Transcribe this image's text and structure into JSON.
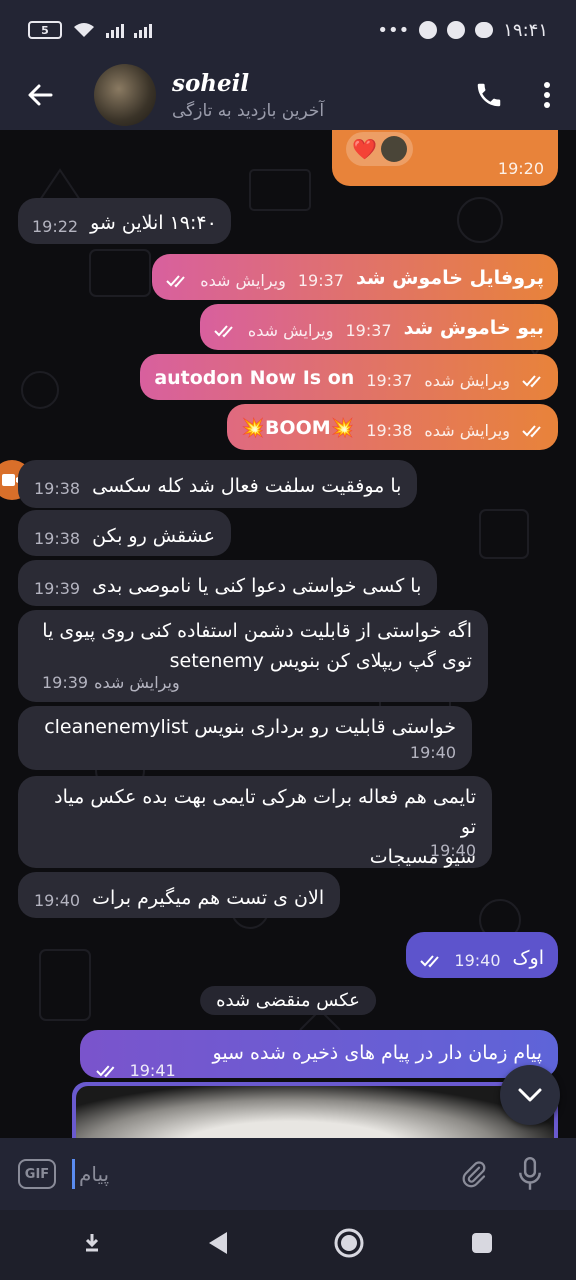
{
  "status_bar": {
    "time": "۱۹:۴۱",
    "battery": "5",
    "dots": "•••"
  },
  "header": {
    "name": "soheil",
    "status": "آخرین بازدید به تازگی",
    "icons": [
      "back-arrow-icon",
      "phone-icon",
      "more-vertical-icon"
    ]
  },
  "messages": [
    {
      "dir": "out",
      "text": "",
      "time": "19:20",
      "edited": "",
      "reaction": "❤️"
    },
    {
      "dir": "in",
      "text": "۱۹:۴۰ انلاین شو",
      "time": "19:22",
      "edited": ""
    },
    {
      "dir": "out",
      "text": "پروفایل خاموش شد",
      "time": "19:37",
      "edited": "ویرایش شده"
    },
    {
      "dir": "out",
      "text": "بیو خاموش شد",
      "time": "19:37",
      "edited": "ویرایش شده"
    },
    {
      "dir": "out",
      "text": "autodon Now Is on",
      "time": "19:37",
      "edited": "ویرایش شده"
    },
    {
      "dir": "out",
      "text": "💥BOOM💥",
      "time": "19:38",
      "edited": "ویرایش شده"
    },
    {
      "dir": "in",
      "text": "با موفقیت سلفت فعال شد کله سکسی",
      "time": "19:38",
      "edited": ""
    },
    {
      "dir": "in",
      "text": "عشقش رو بکن",
      "time": "19:38",
      "edited": ""
    },
    {
      "dir": "in",
      "text": "با کسی خواستی دعوا کنی یا ناموصی بدی",
      "time": "19:39",
      "edited": ""
    },
    {
      "dir": "in",
      "line1": "اگه خواستی از قابلیت دشمن استفاده کنی روی پیوی یا",
      "line2": "توی گپ ریپلای کن بنویس setenemy",
      "time": "19:39",
      "edited": "ویرایش شده"
    },
    {
      "dir": "in",
      "text": "خواستی قابلیت رو برداری بنویس cleanenemylist",
      "time": "19:40",
      "edited": ""
    },
    {
      "dir": "in",
      "line1": "تایمی هم فعاله برات هرکی تایمی بهت بده عکس میاد تو",
      "line2": "سیو مسیجات",
      "time": "19:40",
      "edited": ""
    },
    {
      "dir": "in",
      "text": "الان ی تست هم میگیرم برات",
      "time": "19:40",
      "edited": ""
    },
    {
      "dir": "out",
      "text": "اوک",
      "time": "19:40",
      "edited": ""
    },
    {
      "dir": "out",
      "text": "پیام زمان دار در پیام های ذخیره شده سیو شد",
      "time": "19:41",
      "edited": ""
    }
  ],
  "date_chip": "عکس منقضی شده",
  "composer": {
    "gif": "GIF",
    "placeholder": "پیام"
  },
  "colors": {
    "orange": "#e8833a",
    "pink": "#d8609e",
    "purple": "#7a54cc",
    "incoming": "#2b2b35",
    "bar": "#232534"
  }
}
